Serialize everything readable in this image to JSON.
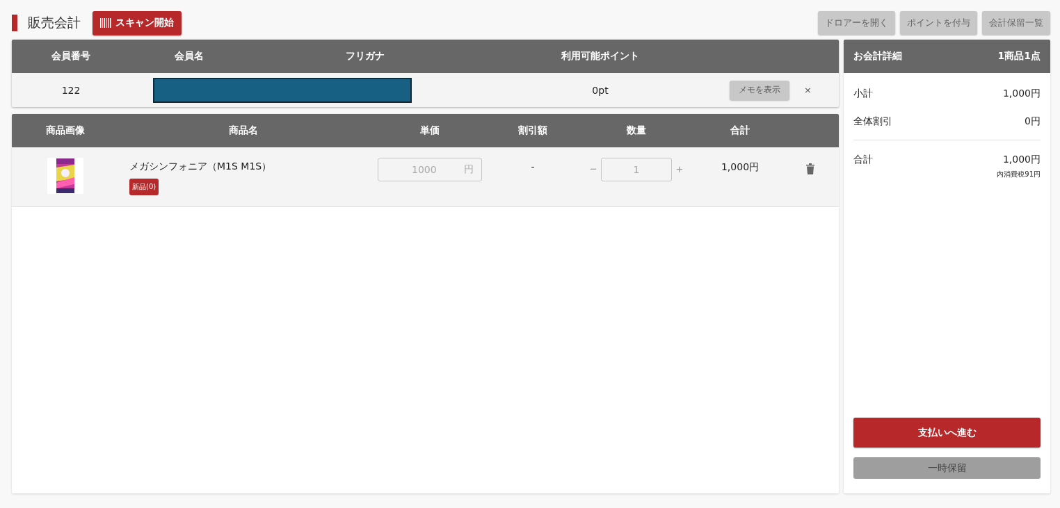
{
  "page_title": "販売会計",
  "scan_button": "スキャン開始",
  "top_buttons": [
    "ドロアーを開く",
    "ポイントを付与",
    "会計保留一覧"
  ],
  "member": {
    "columns": [
      "会員番号",
      "会員名",
      "フリガナ",
      "利用可能ポイント"
    ],
    "number": "122",
    "name_redacted": true,
    "points": "0pt",
    "memo_button": "メモを表示",
    "close": "×"
  },
  "products": {
    "columns": [
      "商品画像",
      "商品名",
      "単価",
      "割引額",
      "数量",
      "合計"
    ],
    "rows": [
      {
        "name": "メガシンフォニア（M1S M1S）",
        "badge": "新品(0)",
        "unit_price": "1000",
        "unit_price_disabled": true,
        "currency": "円",
        "discount": "-",
        "decrement": "−",
        "quantity": "1",
        "quantity_disabled": true,
        "increment": "+",
        "total": "1,000円"
      }
    ]
  },
  "summary": {
    "title": "お会計詳細",
    "count": "1商品1点",
    "lines": [
      {
        "label": "小計",
        "value": "1,000円"
      },
      {
        "label": "全体割引",
        "value": "0円"
      }
    ],
    "total": {
      "label": "合計",
      "value": "1,000円"
    },
    "tax_note": "内消費税91円",
    "pay_button": "支払いへ進む",
    "hold_button": "一時保留"
  }
}
